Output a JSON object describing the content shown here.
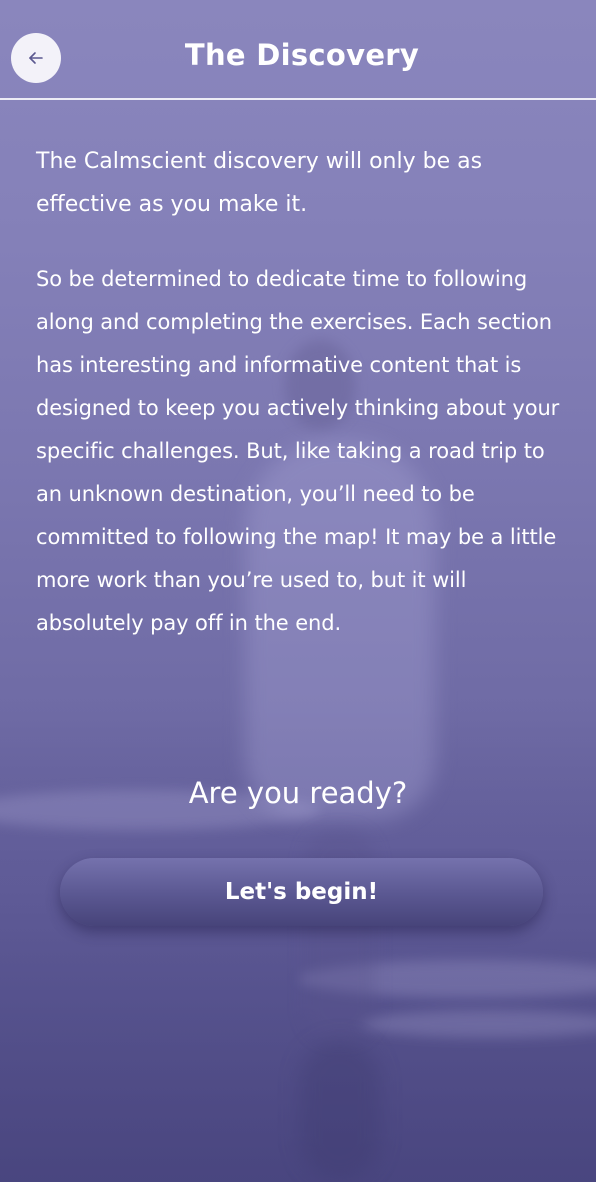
{
  "header": {
    "title": "The Discovery",
    "back_icon": "arrow-left-icon"
  },
  "content": {
    "lead": "The Calmscient discovery will only be as effective as you make it.",
    "body": "So be determined to dedicate time to following along and completing the exercises. Each section has interesting and informative content that is designed to keep you actively thinking about your specific challenges. But, like taking a road trip to an unknown destination, you’ll need to be committed to following the map! It may be a little more work than you’re used to, but it will absolutely pay off in the end."
  },
  "cta": {
    "question": "Are you ready?",
    "begin_label": "Let's begin!"
  },
  "colors": {
    "background_top": "#8a86bd",
    "background_bottom": "#4d4a82",
    "button": "#5a5791",
    "back_button_bg": "#f3f2f9",
    "text": "#ffffff"
  }
}
